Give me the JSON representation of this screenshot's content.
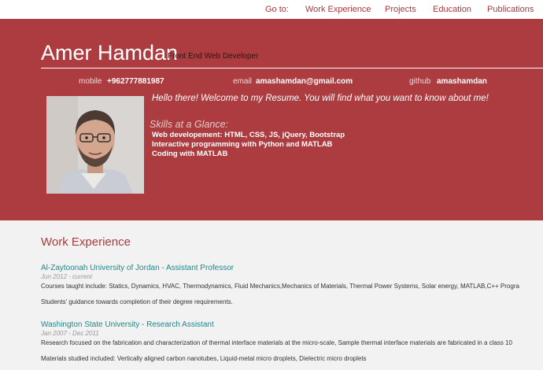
{
  "nav": {
    "goto": "Go to:",
    "items": [
      "Work Experience",
      "Projects",
      "Education",
      "Publications"
    ]
  },
  "header": {
    "name": "Amer Hamdan",
    "role": "Front End Web Developer",
    "contacts": [
      {
        "label": "mobile",
        "value": "+962777881987"
      },
      {
        "label": "email",
        "value": "amashamdan@gmail.com"
      },
      {
        "label": "github",
        "value": "amashamdan"
      }
    ],
    "welcome": "Hello there! Welcome to my Resume. You will find what you want to know about me!",
    "skills_title": "Skills at a Glance:",
    "skills": [
      "Web developement: HTML, CSS, JS, jQuery, Bootstrap",
      "Interactive programming with Python and MATLAB",
      "Coding with MATLAB"
    ]
  },
  "work": {
    "title": "Work Experience",
    "jobs": [
      {
        "title": "Al-Zaytoonah University of Jordan - Assistant Professor",
        "date": "Jun 2012 - current",
        "lines": [
          "Courses taught include: Statics, Dynamics, HVAC, Thermodynamics, Fluid Mechanics,Mechanics of Materials, Thermal Power Systems, Solar energy, MATLAB,C++ Progra",
          "Students' guidance towards completion of their degree requirements."
        ]
      },
      {
        "title": "Washington State University - Research Assistant",
        "date": "Jan 2007 - Dec 2011",
        "lines": [
          "Research focused on the fabrication and characterization of thermal interface materials at the micro-scale, Sample thermal interface materials are fabricated in a class 10",
          "Materials studied included: Vertically aligned carbon nanotubes, Liquid-metal micro droplets, Dielectric micro droplets"
        ]
      }
    ]
  },
  "colors": {
    "brand": "#ad3c40",
    "link": "#21878a"
  }
}
